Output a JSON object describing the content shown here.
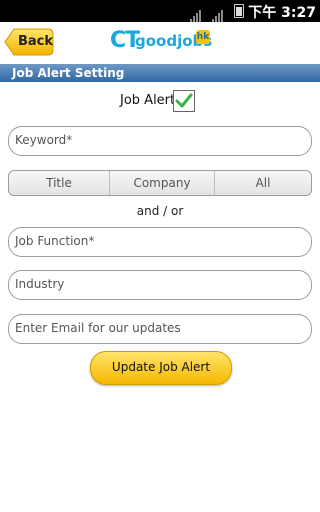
{
  "status": {
    "time": "下午 3:27"
  },
  "header": {
    "back_label": "Back",
    "logo_ct": "CT",
    "logo_text": "goodjobs",
    "logo_badge": "hk"
  },
  "section_title": "Job Alert Setting",
  "job_alert": {
    "label": "Job Alert:",
    "checked": true
  },
  "keyword_placeholder": "Keyword*",
  "segments": [
    "Title",
    "Company",
    "All"
  ],
  "and_or": "and / or",
  "job_function_placeholder": "Job Function*",
  "industry_placeholder": "Industry",
  "email_placeholder": "Enter Email for our updates",
  "update_button_label": "Update Job Alert",
  "colors": {
    "accent_blue": "#2f67a6",
    "button_yellow": "#f5b800",
    "logo_blue": "#18a7e0"
  }
}
